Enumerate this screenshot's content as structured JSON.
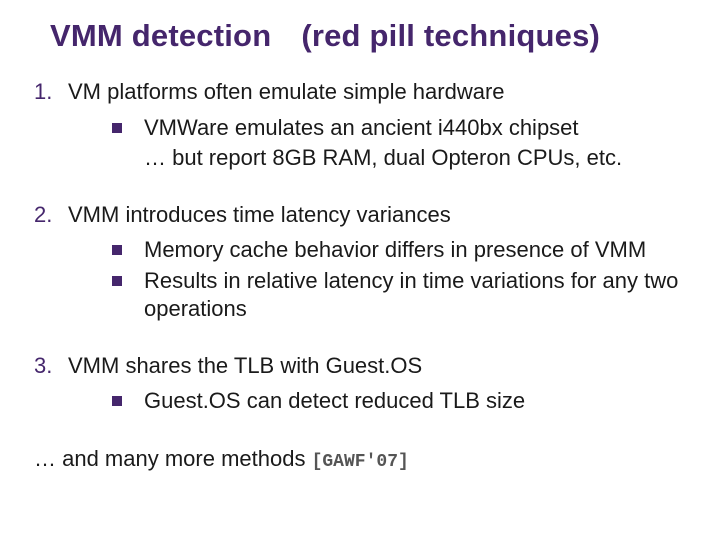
{
  "title_a": "VMM detection",
  "title_b": "(red pill techniques)",
  "pts": [
    {
      "num": "1.",
      "text": "VM platforms often emulate simple hardware",
      "subs": [
        {
          "text": "VMWare emulates an ancient i440bx chipset",
          "cont": "… but report  8GB RAM,  dual Opteron CPUs, etc."
        }
      ]
    },
    {
      "num": "2.",
      "text": "VMM introduces time latency variances",
      "subs": [
        {
          "text": "Memory cache behavior differs in presence of VMM"
        },
        {
          "text": "Results in relative latency in time variations for any two operations"
        }
      ]
    },
    {
      "num": "3.",
      "text": "VMM shares the TLB with Guest.OS",
      "subs": [
        {
          "text": "Guest.OS can detect reduced TLB size"
        }
      ]
    }
  ],
  "closing": "… and many more methods  ",
  "citation": "[GAWF'07]"
}
